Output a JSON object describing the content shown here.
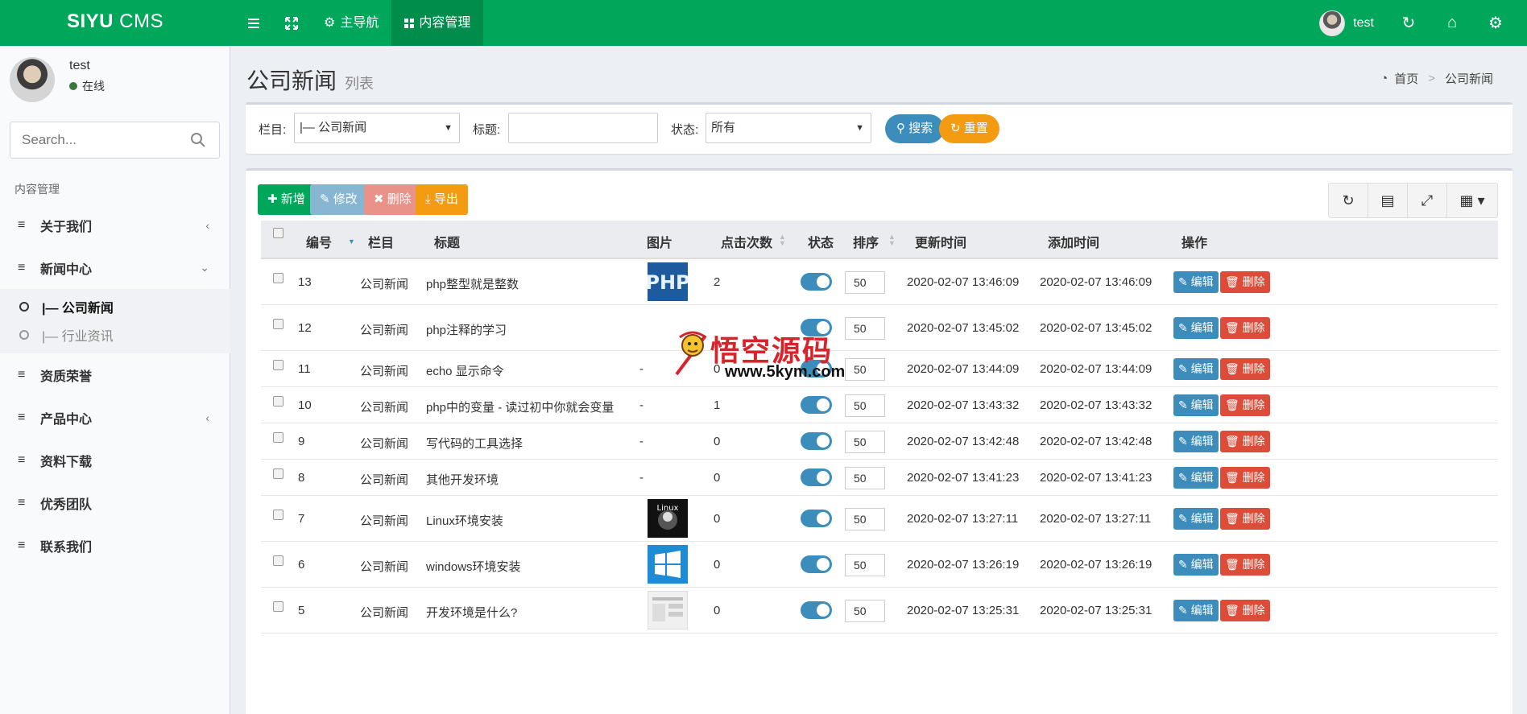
{
  "header": {
    "logo_bold": "SIYU",
    "logo_light": " CMS",
    "nav": [
      {
        "label": ""
      },
      {
        "label": ""
      },
      {
        "label": "主导航"
      },
      {
        "label": "内容管理"
      }
    ],
    "user": "test"
  },
  "sidebar": {
    "user_name": "test",
    "user_status": "在线",
    "search_placeholder": "Search...",
    "menu_header": "内容管理",
    "items": [
      {
        "label": "关于我们"
      },
      {
        "label": "新闻中心"
      },
      {
        "label": "资质荣誉"
      },
      {
        "label": "产品中心"
      },
      {
        "label": "资料下载"
      },
      {
        "label": "优秀团队"
      },
      {
        "label": "联系我们"
      }
    ],
    "sub_items": [
      {
        "label": "|— 公司新闻"
      },
      {
        "label": "|— 行业资讯"
      }
    ]
  },
  "page": {
    "title": "公司新闻",
    "subtitle": "列表",
    "breadcrumb_home": "首页",
    "breadcrumb_current": "公司新闻"
  },
  "filter": {
    "column_label": "栏目:",
    "column_value": "|— 公司新闻",
    "title_label": "标题:",
    "title_value": "",
    "status_label": "状态:",
    "status_value": "所有",
    "search_btn": "搜索",
    "reset_btn": "重置"
  },
  "toolbar": {
    "add": "新增",
    "edit": "修改",
    "delete": "删除",
    "export": "导出"
  },
  "table": {
    "headers": [
      "编号",
      "栏目",
      "标题",
      "图片",
      "点击次数",
      "状态",
      "排序",
      "更新时间",
      "添加时间",
      "操作"
    ],
    "edit_label": "编辑",
    "delete_label": "删除",
    "rows": [
      {
        "id": "13",
        "column": "公司新闻",
        "title": "php整型就是整数",
        "image": "php-thumbnail",
        "clicks": "2",
        "enabled": true,
        "sort": "50",
        "updated": "2020-02-07 13:46:09",
        "created": "2020-02-07 13:46:09"
      },
      {
        "id": "12",
        "column": "公司新闻",
        "title": "php注释的学习",
        "image": "",
        "clicks": "",
        "enabled": true,
        "sort": "50",
        "updated": "2020-02-07 13:45:02",
        "created": "2020-02-07 13:45:02"
      },
      {
        "id": "11",
        "column": "公司新闻",
        "title": "echo 显示命令",
        "image": "-",
        "clicks": "0",
        "enabled": true,
        "sort": "50",
        "updated": "2020-02-07 13:44:09",
        "created": "2020-02-07 13:44:09"
      },
      {
        "id": "10",
        "column": "公司新闻",
        "title": "php中的变量 - 读过初中你就会变量",
        "image": "-",
        "clicks": "1",
        "enabled": true,
        "sort": "50",
        "updated": "2020-02-07 13:43:32",
        "created": "2020-02-07 13:43:32"
      },
      {
        "id": "9",
        "column": "公司新闻",
        "title": "写代码的工具选择",
        "image": "-",
        "clicks": "0",
        "enabled": true,
        "sort": "50",
        "updated": "2020-02-07 13:42:48",
        "created": "2020-02-07 13:42:48"
      },
      {
        "id": "8",
        "column": "公司新闻",
        "title": "其他开发环境",
        "image": "-",
        "clicks": "0",
        "enabled": true,
        "sort": "50",
        "updated": "2020-02-07 13:41:23",
        "created": "2020-02-07 13:41:23"
      },
      {
        "id": "7",
        "column": "公司新闻",
        "title": "Linux环境安装",
        "image": "linux-thumbnail",
        "clicks": "0",
        "enabled": true,
        "sort": "50",
        "updated": "2020-02-07 13:27:11",
        "created": "2020-02-07 13:27:11"
      },
      {
        "id": "6",
        "column": "公司新闻",
        "title": "windows环境安装",
        "image": "windows-thumbnail",
        "clicks": "0",
        "enabled": true,
        "sort": "50",
        "updated": "2020-02-07 13:26:19",
        "created": "2020-02-07 13:26:19"
      },
      {
        "id": "5",
        "column": "公司新闻",
        "title": "开发环境是什么?",
        "image": "screenshot-thumbnail",
        "clicks": "0",
        "enabled": true,
        "sort": "50",
        "updated": "2020-02-07 13:25:31",
        "created": "2020-02-07 13:25:31"
      }
    ]
  },
  "watermark": {
    "name": "悟空源码",
    "url": "www.5kym.com"
  },
  "colors": {
    "header": "#00a65a",
    "primary": "#3c8dbc",
    "danger": "#dd4b39",
    "warning": "#f39c12",
    "success": "#00a65a"
  }
}
